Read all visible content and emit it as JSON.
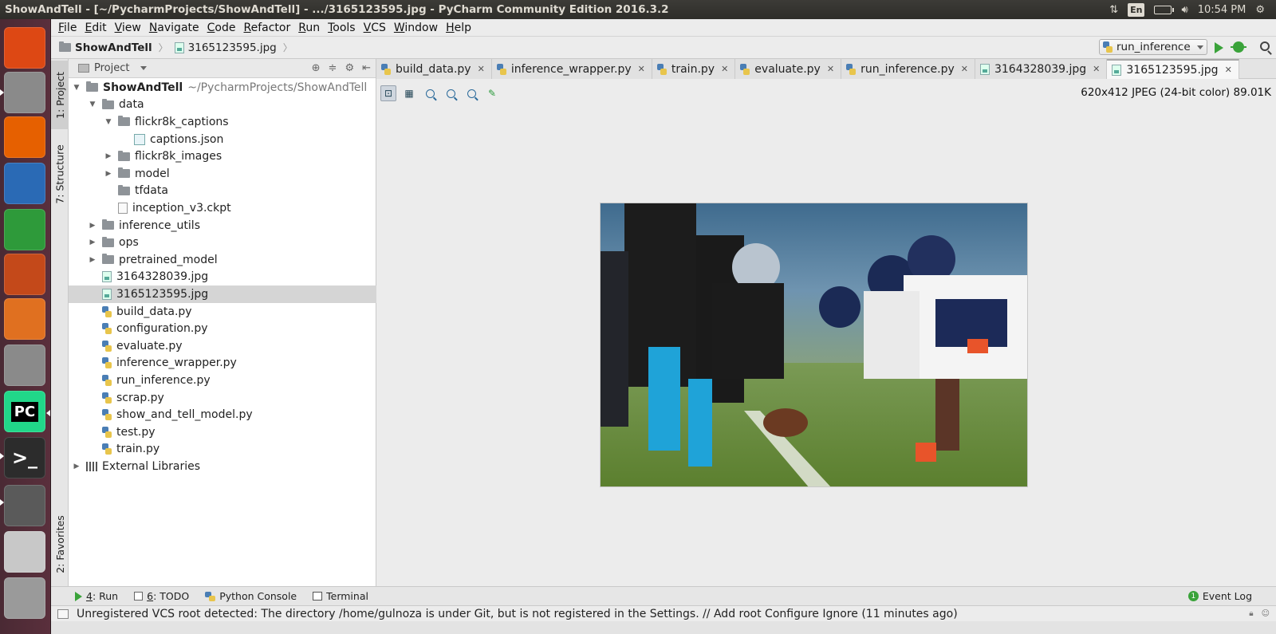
{
  "window": {
    "title": "ShowAndTell - [~/PycharmProjects/ShowAndTell] - .../3165123595.jpg - PyCharm Community Edition 2016.3.2"
  },
  "system_tray": {
    "keyboard_layout": "En",
    "clock": "10:54 PM"
  },
  "launcher": {
    "items": [
      {
        "name": "ubuntu-dash-icon",
        "color": "#dd4814"
      },
      {
        "name": "files-icon",
        "color": "#8a8a8a"
      },
      {
        "name": "firefox-icon",
        "color": "#e66000"
      },
      {
        "name": "writer-icon",
        "color": "#2a6ab5"
      },
      {
        "name": "calc-icon",
        "color": "#2e9a3a"
      },
      {
        "name": "impress-icon",
        "color": "#c4491a"
      },
      {
        "name": "software-center-icon",
        "color": "#e07020"
      },
      {
        "name": "system-settings-icon",
        "color": "#8a8a8a"
      },
      {
        "name": "pycharm-icon",
        "color": "#21d789",
        "glyph": "PC"
      },
      {
        "name": "terminal-icon",
        "color": "#2c2c2c",
        "glyph": ">_"
      },
      {
        "name": "software-updater-icon",
        "color": "#5a5a5a"
      },
      {
        "name": "dvd-icon",
        "color": "#c8c8c8"
      },
      {
        "name": "trash-icon",
        "color": "#9a9a9a"
      }
    ]
  },
  "menubar": {
    "items": [
      "File",
      "Edit",
      "View",
      "Navigate",
      "Code",
      "Refactor",
      "Run",
      "Tools",
      "VCS",
      "Window",
      "Help"
    ]
  },
  "navbar": {
    "project": "ShowAndTell",
    "file": "3165123595.jpg",
    "run_config": "run_inference"
  },
  "side_tabs": {
    "project": "1: Project",
    "structure": "7: Structure",
    "favorites": "2: Favorites"
  },
  "project_panel": {
    "title": "Project",
    "tree": [
      {
        "label": "ShowAndTell",
        "suffix": "~/PycharmProjects/ShowAndTell",
        "depth": 0,
        "icon": "folder",
        "toggle": "open",
        "bold": true
      },
      {
        "label": "data",
        "depth": 1,
        "icon": "folder",
        "toggle": "open"
      },
      {
        "label": "flickr8k_captions",
        "depth": 2,
        "icon": "folder",
        "toggle": "open"
      },
      {
        "label": "captions.json",
        "depth": 3,
        "icon": "json"
      },
      {
        "label": "flickr8k_images",
        "depth": 2,
        "icon": "folder",
        "toggle": "closed"
      },
      {
        "label": "model",
        "depth": 2,
        "icon": "folder",
        "toggle": "closed"
      },
      {
        "label": "tfdata",
        "depth": 2,
        "icon": "folder"
      },
      {
        "label": "inception_v3.ckpt",
        "depth": 2,
        "icon": "ckpt"
      },
      {
        "label": "inference_utils",
        "depth": 1,
        "icon": "folder",
        "toggle": "closed"
      },
      {
        "label": "ops",
        "depth": 1,
        "icon": "folder",
        "toggle": "closed"
      },
      {
        "label": "pretrained_model",
        "depth": 1,
        "icon": "folder",
        "toggle": "closed"
      },
      {
        "label": "3164328039.jpg",
        "depth": 1,
        "icon": "image"
      },
      {
        "label": "3165123595.jpg",
        "depth": 1,
        "icon": "image",
        "selected": true
      },
      {
        "label": "build_data.py",
        "depth": 1,
        "icon": "python"
      },
      {
        "label": "configuration.py",
        "depth": 1,
        "icon": "python"
      },
      {
        "label": "evaluate.py",
        "depth": 1,
        "icon": "python"
      },
      {
        "label": "inference_wrapper.py",
        "depth": 1,
        "icon": "python"
      },
      {
        "label": "run_inference.py",
        "depth": 1,
        "icon": "python"
      },
      {
        "label": "scrap.py",
        "depth": 1,
        "icon": "python"
      },
      {
        "label": "show_and_tell_model.py",
        "depth": 1,
        "icon": "python"
      },
      {
        "label": "test.py",
        "depth": 1,
        "icon": "python"
      },
      {
        "label": "train.py",
        "depth": 1,
        "icon": "python"
      },
      {
        "label": "External Libraries",
        "depth": 0,
        "icon": "library",
        "toggle": "closed"
      }
    ]
  },
  "editor_tabs": [
    {
      "label": "build_data.py",
      "icon": "python"
    },
    {
      "label": "inference_wrapper.py",
      "icon": "python"
    },
    {
      "label": "train.py",
      "icon": "python"
    },
    {
      "label": "evaluate.py",
      "icon": "python"
    },
    {
      "label": "run_inference.py",
      "icon": "python"
    },
    {
      "label": "3164328039.jpg",
      "icon": "image"
    },
    {
      "label": "3165123595.jpg",
      "icon": "image",
      "active": true
    }
  ],
  "image_viewer": {
    "info": "620x412 JPEG (24-bit color) 89.01K"
  },
  "bottom_tools": {
    "run": {
      "num": "4",
      "label": ": Run"
    },
    "todo": {
      "num": "6",
      "label": ": TODO"
    },
    "python_console": "Python Console",
    "terminal": "Terminal",
    "event_log": "Event Log",
    "event_count": "1"
  },
  "statusbar": {
    "message": "Unregistered VCS root detected: The directory /home/gulnoza is under Git, but is not registered in the Settings. // Add root  Configure  Ignore (11 minutes ago)"
  }
}
